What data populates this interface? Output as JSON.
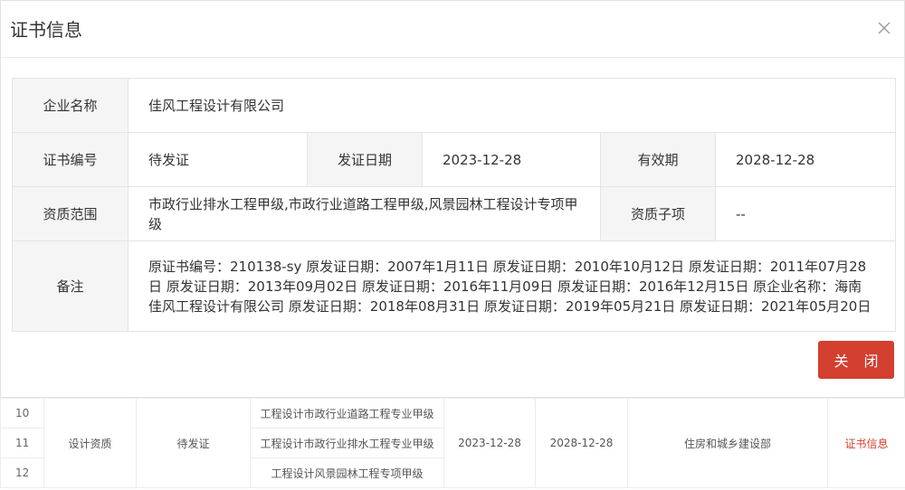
{
  "modal": {
    "title": "证书信息",
    "close_icon": "close-icon",
    "fields": {
      "company_label": "企业名称",
      "company_value": "佳风工程设计有限公司",
      "cert_no_label": "证书编号",
      "cert_no_value": "待发证",
      "issue_date_label": "发证日期",
      "issue_date_value": "2023-12-28",
      "valid_label": "有效期",
      "valid_value": "2028-12-28",
      "scope_label": "资质范围",
      "scope_value": "市政行业排水工程甲级,市政行业道路工程甲级,风景园林工程设计专项甲级",
      "sub_label": "资质子项",
      "sub_value": "--",
      "remark_label": "备注",
      "remark_value": "原证书编号：210138-sy 原发证日期：2007年1月11日 原发证日期：2010年10月12日 原发证日期：2011年07月28日 原发证日期：2013年09月02日 原发证日期：2016年11月09日 原发证日期：2016年12月15日 原企业名称：海南佳风工程设计有限公司 原发证日期：2018年08月31日 原发证日期：2019年05月21日 原发证日期：2021年05月20日"
    },
    "close_button": "关 闭"
  },
  "background_table": {
    "rows": [
      {
        "index": "10",
        "item": "工程设计市政行业道路工程专业甲级"
      },
      {
        "index": "11",
        "item": "工程设计市政行业排水工程专业甲级"
      },
      {
        "index": "12",
        "item": "工程设计风景园林工程专项甲级"
      }
    ],
    "category": "设计资质",
    "cert_no": "待发证",
    "issue_date": "2023-12-28",
    "valid_date": "2028-12-28",
    "authority": "住房和城乡建设部",
    "action": "证书信息",
    "action_color": "#d23f2f"
  }
}
